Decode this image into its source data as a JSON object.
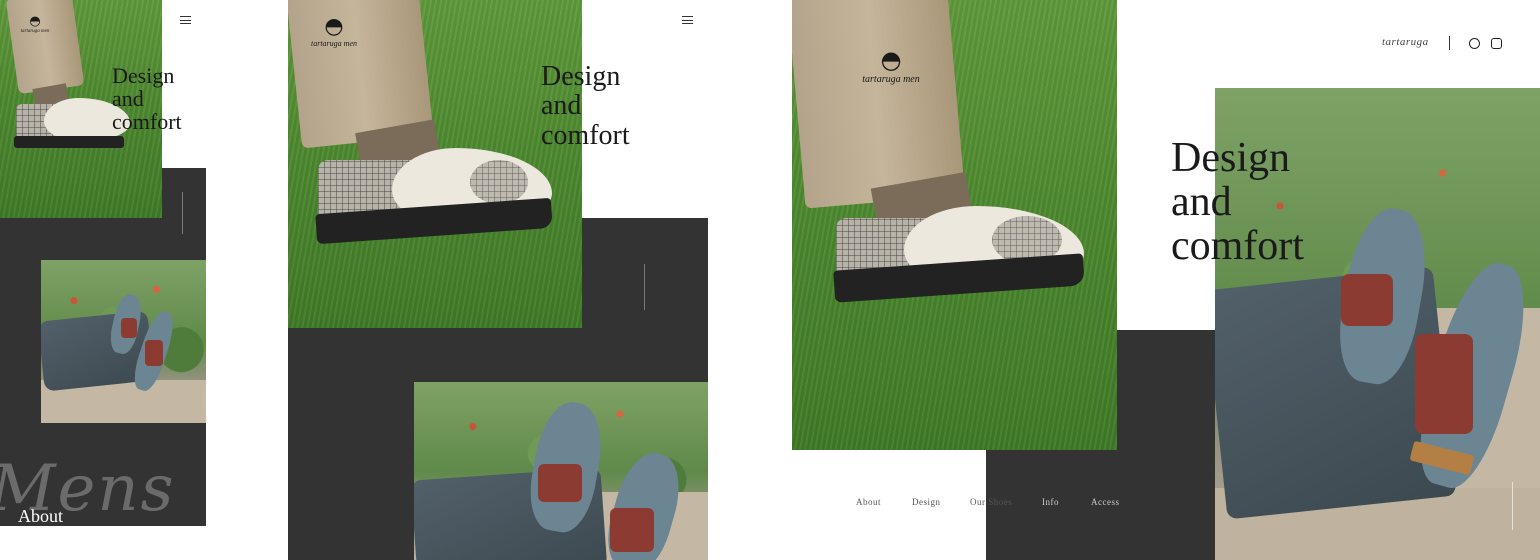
{
  "brand": {
    "logo_text": "tartaruga men",
    "header_brand": "tartaruga",
    "logo_mark": "turtle-logo"
  },
  "hero": {
    "title_lines": [
      "Design",
      "and",
      "comfort"
    ]
  },
  "sections": {
    "about_label": "About",
    "script_word": "Mens"
  },
  "nav": {
    "items": [
      "About",
      "Design",
      "Our Shoes",
      "Info",
      "Access"
    ]
  },
  "icons": {
    "menu": "menu-icon",
    "facebook": "facebook-icon",
    "instagram": "instagram-icon"
  },
  "colors": {
    "dark_panel": "#333333",
    "text": "#1a1a1a",
    "background": "#ffffff"
  }
}
